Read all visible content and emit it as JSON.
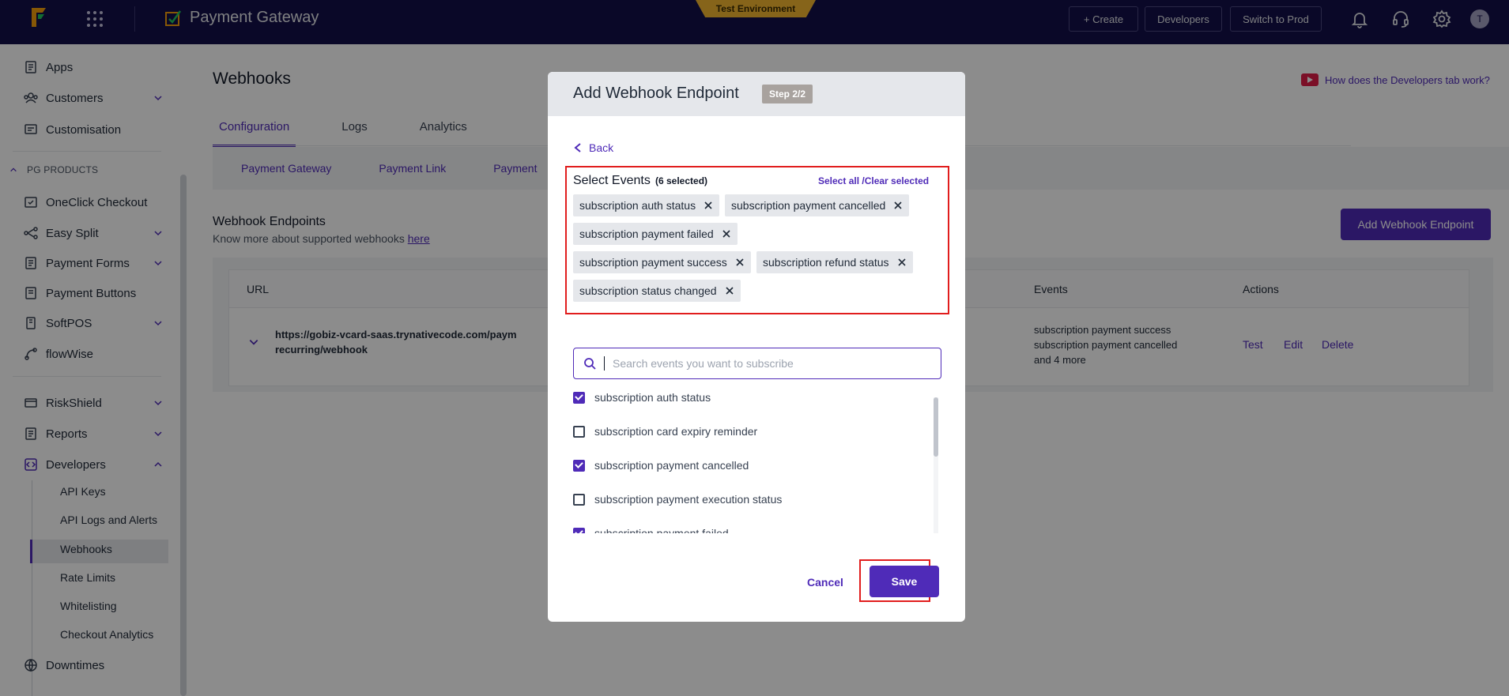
{
  "topbar": {
    "app_title": "Payment Gateway",
    "env_badge": "Test Environment",
    "create_label": "+ Create",
    "developers_label": "Developers",
    "switch_label": "Switch to Prod",
    "avatar_initial": "T"
  },
  "sidebar": {
    "items": [
      {
        "label": "Apps"
      },
      {
        "label": "Customers"
      },
      {
        "label": "Customisation"
      },
      {
        "label": "OneClick Checkout"
      },
      {
        "label": "Easy Split"
      },
      {
        "label": "Payment Forms"
      },
      {
        "label": "Payment Buttons"
      },
      {
        "label": "SoftPOS"
      },
      {
        "label": "flowWise"
      },
      {
        "label": "RiskShield"
      },
      {
        "label": "Reports"
      },
      {
        "label": "Developers"
      },
      {
        "label": "Downtimes"
      }
    ],
    "section_label": "PG PRODUCTS",
    "sub_items": [
      {
        "label": "API Keys"
      },
      {
        "label": "API Logs and Alerts"
      },
      {
        "label": "Webhooks"
      },
      {
        "label": "Rate Limits"
      },
      {
        "label": "Whitelisting"
      },
      {
        "label": "Checkout Analytics"
      }
    ]
  },
  "main": {
    "page_title": "Webhooks",
    "help_link": "How does the Developers tab work?",
    "tabs": [
      {
        "label": "Configuration"
      },
      {
        "label": "Logs"
      },
      {
        "label": "Analytics"
      }
    ],
    "subtabs": [
      {
        "label": "Payment Gateway"
      },
      {
        "label": "Payment Link"
      },
      {
        "label": "Payment"
      }
    ],
    "endpoints_title": "Webhook Endpoints",
    "endpoints_sub": "Know more about supported webhooks",
    "endpoints_link": "here",
    "add_button": "Add Webhook Endpoint",
    "table": {
      "headers": {
        "url": "URL",
        "events": "Events",
        "actions": "Actions"
      },
      "row": {
        "url_line1": "https://gobiz-vcard-saas.trynativecode.com/paym",
        "url_line2": "recurring/webhook",
        "events_line1": "subscription payment success",
        "events_line2": "subscription payment cancelled",
        "events_line3": "and 4 more",
        "action_test": "Test",
        "action_edit": "Edit",
        "action_delete": "Delete"
      }
    }
  },
  "modal": {
    "title": "Add Webhook Endpoint",
    "step": "Step 2/2",
    "back_label": "Back",
    "select_title": "Select Events",
    "selected_count": "(6 selected)",
    "select_links": "Select all /Clear selected",
    "chips": [
      {
        "label": "subscription auth status"
      },
      {
        "label": "subscription payment cancelled"
      },
      {
        "label": "subscription payment failed"
      },
      {
        "label": "subscription payment success"
      },
      {
        "label": "subscription refund status"
      },
      {
        "label": "subscription status changed"
      }
    ],
    "search_placeholder": "Search events you want to subscribe",
    "options": [
      {
        "label": "subscription auth status",
        "checked": true
      },
      {
        "label": "subscription card expiry reminder",
        "checked": false
      },
      {
        "label": "subscription payment cancelled",
        "checked": true
      },
      {
        "label": "subscription payment execution status",
        "checked": false
      },
      {
        "label": "subscription payment failed",
        "checked": true
      }
    ],
    "cancel_label": "Cancel",
    "save_label": "Save"
  },
  "colors": {
    "brand": "#4f2bb8",
    "topbar": "#13104a",
    "env_badge": "#f5b731",
    "highlight_border": "#e11d1d"
  }
}
